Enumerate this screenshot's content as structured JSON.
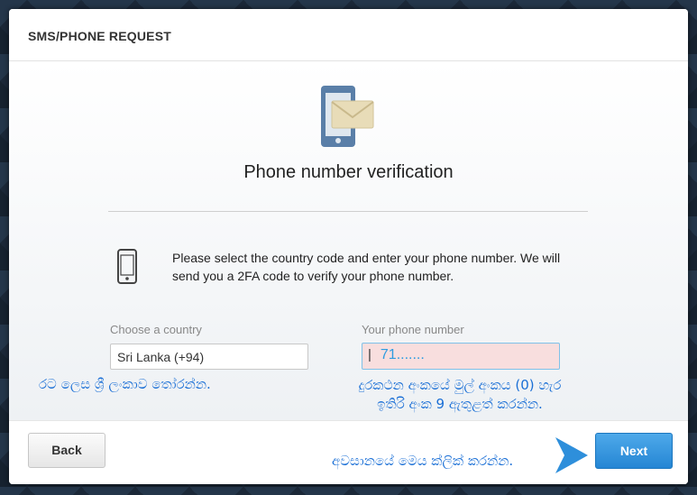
{
  "dialog": {
    "title": "SMS/PHONE REQUEST",
    "heading": "Phone number verification",
    "instructions": "Please select the country code and enter your phone number. We will send you a 2FA code to verify your phone number."
  },
  "form": {
    "country_label": "Choose a country",
    "country_value": "Sri Lanka (+94)",
    "phone_label": "Your phone number",
    "phone_value": "71......."
  },
  "annotations": {
    "country_note": "රට ලෙස ශ්‍රී ලංකාව තෝරන්න.",
    "phone_note_line1": "දුරකථන අංකයේ මුල් අංකය (0) හැර",
    "phone_note_line2": "ඉතිරි අංක 9 ඇතුළත් කරන්න.",
    "next_note": "අවසානයේ මෙය ක්ලික් කරන්න."
  },
  "footer": {
    "back_label": "Back",
    "next_label": "Next"
  },
  "icons": {
    "hero": "phone-envelope-icon",
    "phone": "mobile-phone-icon",
    "arrow": "arrow-right-icon"
  },
  "colors": {
    "accent": "#2e8fdb",
    "annotation": "#1a6fd6",
    "phone_field_bg": "#f8dede"
  }
}
